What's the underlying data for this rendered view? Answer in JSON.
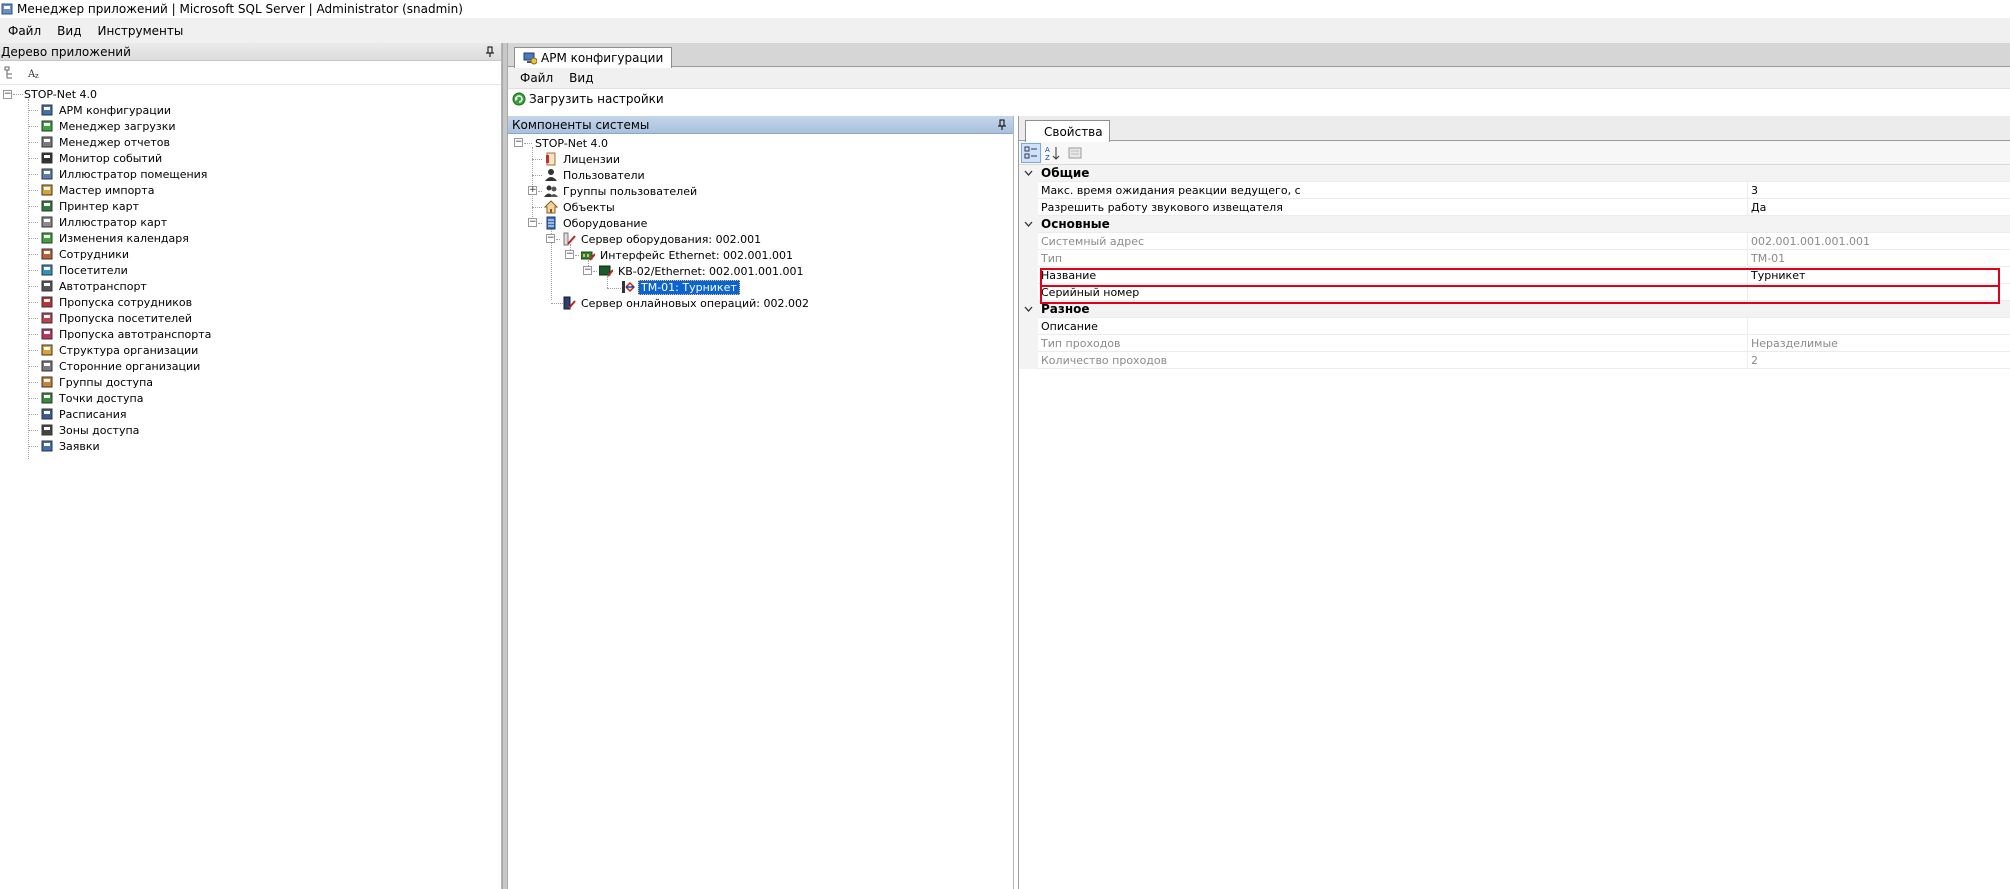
{
  "window": {
    "title": "Менеджер приложений | Microsoft SQL Server | Administrator  (snadmin)"
  },
  "menu": {
    "items": [
      "Файл",
      "Вид",
      "Инструменты"
    ]
  },
  "app_tree_panel": {
    "title": "Дерево приложений",
    "root": "STOP-Net 4.0",
    "items": [
      {
        "label": "АРМ конфигурации",
        "icon": "workstation-config-icon"
      },
      {
        "label": "Менеджер загрузки",
        "icon": "download-manager-icon"
      },
      {
        "label": "Менеджер отчетов",
        "icon": "reports-icon"
      },
      {
        "label": "Монитор событий",
        "icon": "eye-icon"
      },
      {
        "label": "Иллюстратор помещения",
        "icon": "building-icon"
      },
      {
        "label": "Мастер импорта",
        "icon": "import-icon"
      },
      {
        "label": "Принтер карт",
        "icon": "card-printer-icon"
      },
      {
        "label": "Иллюстратор карт",
        "icon": "card-designer-icon"
      },
      {
        "label": "Изменения календаря",
        "icon": "calendar-icon"
      },
      {
        "label": "Сотрудники",
        "icon": "employees-icon"
      },
      {
        "label": "Посетители",
        "icon": "visitors-icon"
      },
      {
        "label": "Автотранспорт",
        "icon": "car-icon"
      },
      {
        "label": "Пропуска сотрудников",
        "icon": "employee-pass-icon"
      },
      {
        "label": "Пропуска посетителей",
        "icon": "visitor-pass-icon"
      },
      {
        "label": "Пропуска автотранспорта",
        "icon": "vehicle-pass-icon"
      },
      {
        "label": "Структура организации",
        "icon": "org-structure-icon"
      },
      {
        "label": "Сторонние организации",
        "icon": "external-org-icon"
      },
      {
        "label": "Группы доступа",
        "icon": "access-groups-icon"
      },
      {
        "label": "Точки доступа",
        "icon": "access-points-icon"
      },
      {
        "label": "Расписания",
        "icon": "schedule-icon"
      },
      {
        "label": "Зоны доступа",
        "icon": "access-zones-icon"
      },
      {
        "label": "Заявки",
        "icon": "requests-icon"
      }
    ]
  },
  "document": {
    "tab_label": "АРМ конфигурации",
    "menu": [
      "Файл",
      "Вид"
    ],
    "toolbar_load": "Загрузить настройки"
  },
  "components_panel": {
    "title": "Компоненты системы",
    "root": "STOP-Net 4.0",
    "licenses": "Лицензии",
    "users": "Пользователи",
    "user_groups": "Группы пользователей",
    "objects": "Объекты",
    "equipment": "Оборудование",
    "equipment_server": "Сервер оборудования: 002.001",
    "ethernet_interface": "Интерфейс Ethernet: 002.001.001",
    "controller": "KB-02/Ethernet: 002.001.001.001",
    "turnstile": "TM-01: Турникет",
    "online_server": "Сервер онлайновых операций: 002.002"
  },
  "properties_panel": {
    "tab_label": "Свойства",
    "categories": {
      "general": {
        "title": "Общие",
        "rows": [
          {
            "name": "Макс. время ожидания реакции ведущего, с",
            "value": "3"
          },
          {
            "name": "Разрешить работу звукового извещателя",
            "value": "Да"
          }
        ]
      },
      "main": {
        "title": "Основные",
        "rows": [
          {
            "name": "Системный адрес",
            "value": "002.001.001.001.001"
          },
          {
            "name": "Тип",
            "value": "TM-01"
          },
          {
            "name": "Название",
            "value": "Турникет"
          },
          {
            "name": "Серийный номер",
            "value": ""
          }
        ]
      },
      "misc": {
        "title": "Разное",
        "rows": [
          {
            "name": "Описание",
            "value": ""
          },
          {
            "name": "Тип проходов",
            "value": "Неразделимые"
          },
          {
            "name": "Количество проходов",
            "value": "2"
          }
        ]
      }
    }
  },
  "colors": {
    "selection": "#0a64d2",
    "highlight_box": "#e0001a",
    "blue_header": "#b6cbe3"
  }
}
